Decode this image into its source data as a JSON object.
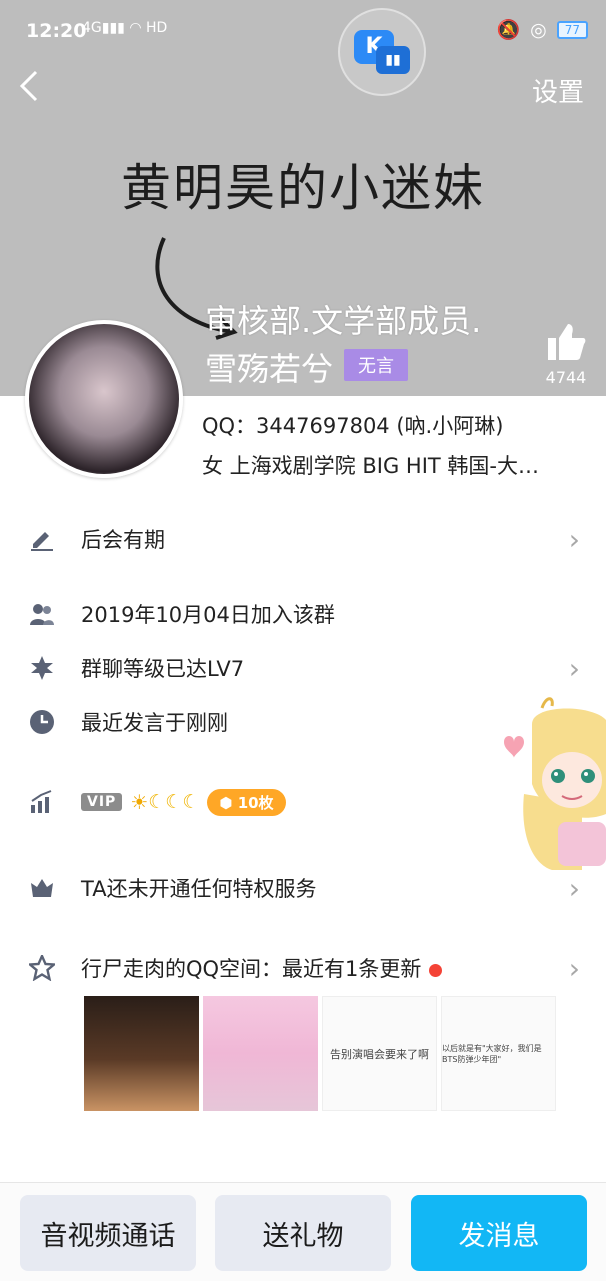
{
  "status_bar": {
    "time": "12:20",
    "network": "4G",
    "battery": "77"
  },
  "header": {
    "back_icon": "chevron-left-icon",
    "settings_label": "设置",
    "cover_text": "黄明昊的小迷妹",
    "nickname_line1": "审核部.文学部成员.",
    "nickname_line2": "雪殇若兮",
    "badge": "无言",
    "like_count": "4744"
  },
  "profile": {
    "qq_line": "QQ：3447697804 (吶.小阿琳)",
    "info_line": "女  上海戏剧学院  BIG HIT  韩国-大…"
  },
  "rows": {
    "signature": "后会有期",
    "joined": "2019年10月04日加入该群",
    "level": "群聊等级已达LV7",
    "last_spoke": "最近发言于刚刚",
    "vip_label": "VIP",
    "coins": "10枚",
    "privilege": "TA还未开通任何特权服务",
    "qzone": "行尸走肉的QQ空间：最近有1条更新"
  },
  "photos": {
    "p3_text": "告别演唱会要来了啊",
    "p4_text": "以后就是有\"大家好，我们是BTS防弹少年团\""
  },
  "buttons": {
    "call": "音视频通话",
    "gift": "送礼物",
    "message": "发消息"
  },
  "colors": {
    "accent": "#12b7f5",
    "badge": "#a98be6",
    "coin": "#ffa726",
    "dot": "#f44336"
  }
}
